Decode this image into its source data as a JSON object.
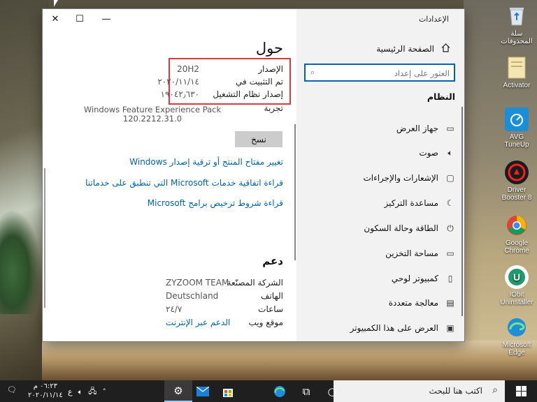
{
  "desktop": {
    "icons": [
      {
        "label": "سلة المحذوفات",
        "icon": "recycle-bin-icon"
      },
      {
        "label": "Activator",
        "icon": "folder-icon"
      },
      {
        "label": "AVG TuneUp",
        "icon": "avg-tuneup-icon"
      },
      {
        "label": "Driver Booster 8",
        "icon": "driver-booster-icon"
      },
      {
        "label": "Google Chrome",
        "icon": "chrome-icon"
      },
      {
        "label": "IObit Uninstaller",
        "icon": "iobit-uninstaller-icon"
      },
      {
        "label": "Microsoft Edge",
        "icon": "edge-icon"
      }
    ]
  },
  "window": {
    "title": "الإعدادات",
    "controls": {
      "close": "✕",
      "maximize": "☐",
      "minimize": "—"
    }
  },
  "sidebar": {
    "home_label": "الصفحة الرئيسية",
    "search_placeholder": "العثور على إعداد",
    "section_title": "النظام",
    "items": [
      {
        "label": "جهاز العرض",
        "icon": "display-icon"
      },
      {
        "label": "صوت",
        "icon": "sound-icon"
      },
      {
        "label": "الإشعارات والإجراءات",
        "icon": "notifications-icon"
      },
      {
        "label": "مساعدة التركيز",
        "icon": "focus-assist-icon"
      },
      {
        "label": "الطاقة وحالة السكون",
        "icon": "power-icon"
      },
      {
        "label": "مساحة التخزين",
        "icon": "storage-icon"
      },
      {
        "label": "كمبيوتر لوحي",
        "icon": "tablet-icon"
      },
      {
        "label": "معالجة متعددة",
        "icon": "multitasking-icon"
      },
      {
        "label": "العرض على هذا الكمبيوتر",
        "icon": "projecting-icon"
      }
    ]
  },
  "about": {
    "title": "حول",
    "specs": [
      {
        "label": "الإصدار",
        "value": "20H2"
      },
      {
        "label": "تم التثبيت في",
        "value": "٢٠٢٠/١١/١٤"
      },
      {
        "label": "إصدار نظام التشغيل",
        "value": "١٩٠٤٢٫٦٣٠"
      }
    ],
    "experience_label": "تجربة",
    "experience_value": "Windows Feature Experience Pack",
    "experience_version": "120.2212.31.0",
    "copy_button": "نسخ",
    "links": [
      "تغيير مفتاح المنتج أو ترقية إصدار Windows",
      "قراءة اتفاقية خدمات Microsoft التي تنطبق على خدماتنا",
      "قراءة شروط ترخيص برامج Microsoft"
    ]
  },
  "support": {
    "title": "دعم",
    "rows": [
      {
        "label": "الشركة المصنّعة",
        "value": "ZYZOOM TEAM"
      },
      {
        "label": "الهاتف",
        "value": "Deutschland"
      },
      {
        "label": "ساعات",
        "value": "٢٤/٧"
      },
      {
        "label": "موقع ويب",
        "value": "الدعم عبر الإنترنت"
      }
    ]
  },
  "taskbar": {
    "search_placeholder": "اكتب هنا للبحث",
    "time": "٠٦:٢٣ م",
    "date": "٢٠٢٠/١١/١٤",
    "language": "ع",
    "accent": "#9ec9f0"
  }
}
